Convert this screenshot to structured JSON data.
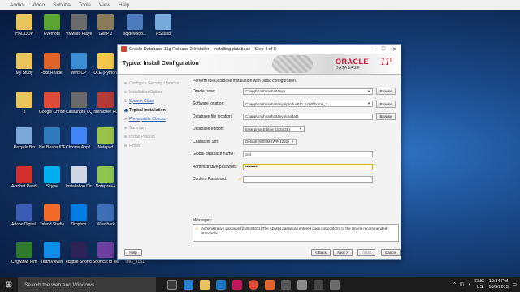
{
  "player_menu": [
    "Audio",
    "Video",
    "Subtitle",
    "Tools",
    "View",
    "Help"
  ],
  "desktop_icons": [
    {
      "label": "HADOOP",
      "icon": "folder-icon",
      "color": "#e9c45b"
    },
    {
      "label": "Evernote",
      "icon": "evernote-icon",
      "color": "#5aa432"
    },
    {
      "label": "VMware Player",
      "icon": "vmware-icon",
      "color": "#6b6b6b"
    },
    {
      "label": "GIMP 2",
      "icon": "gimp-icon",
      "color": "#8b7b5b"
    },
    {
      "label": "sqldevelop...",
      "icon": "sqldeveloper-icon",
      "color": "#4c7bbd"
    },
    {
      "label": "RStudio",
      "icon": "rstudio-icon",
      "color": "#75aadb"
    },
    {
      "label": "My Study",
      "icon": "folder-icon",
      "color": "#e9c45b"
    },
    {
      "label": "Foxit Reader",
      "icon": "foxit-icon",
      "color": "#e0632a"
    },
    {
      "label": "WinSCP",
      "icon": "winscp-icon",
      "color": "#3a8fd6"
    },
    {
      "label": "IDLE (Python GUI)",
      "icon": "python-icon",
      "color": "#f2c94c"
    },
    {
      "label": "8",
      "icon": "folder-icon",
      "color": "#e9c45b"
    },
    {
      "label": "Google Chrome",
      "icon": "chrome-icon",
      "color": "#dd4b39"
    },
    {
      "label": "Cassandra CQL Shell",
      "icon": "cassandra-icon",
      "color": "#6a6a6a"
    },
    {
      "label": "Interactive Ruby",
      "icon": "ruby-icon",
      "color": "#b33a3a"
    },
    {
      "label": "Recycle Bin",
      "icon": "recycle-bin-icon",
      "color": "#7aa7d8"
    },
    {
      "label": "Net Beans IDE 8.0.2",
      "icon": "netbeans-icon",
      "color": "#2f7bbd"
    },
    {
      "label": "Chrome App Launcher",
      "icon": "app-launcher-icon",
      "color": "#4285f4"
    },
    {
      "label": "Notepad",
      "icon": "notepad-icon",
      "color": "#9bc34a"
    },
    {
      "label": "Acrobat Reader DC",
      "icon": "acrobat-icon",
      "color": "#d32f2f"
    },
    {
      "label": "Skype",
      "icon": "skype-icon",
      "color": "#00aff0"
    },
    {
      "label": "Installation Directive",
      "icon": "document-icon",
      "color": "#cfd8e3"
    },
    {
      "label": "Notepad++",
      "icon": "notepadpp-icon",
      "color": "#8fc650"
    },
    {
      "label": "Adobe Digital Ed...",
      "icon": "digital-editions-icon",
      "color": "#3b5bb5"
    },
    {
      "label": "Talend Studio",
      "icon": "talend-icon",
      "color": "#f26b2a"
    },
    {
      "label": "Dropbox",
      "icon": "dropbox-icon",
      "color": "#007ee5"
    },
    {
      "label": "Wireshark",
      "icon": "wireshark-icon",
      "color": "#3d6fb6"
    },
    {
      "label": "CygwinM Terminal",
      "icon": "cygwin-icon",
      "color": "#2d7a2d"
    },
    {
      "label": "TeamViewer",
      "icon": "teamviewer-icon",
      "color": "#0e8ee9"
    },
    {
      "label": "eclipse Shortcut",
      "icon": "eclipse-icon",
      "color": "#2c2255"
    },
    {
      "label": "Shortcut to Winst...",
      "icon": "shortcut-icon",
      "color": "#6a3fa0"
    },
    {
      "label": "IMG_9151",
      "icon": "image-icon",
      "color": "#8a9bb0"
    }
  ],
  "window": {
    "title": "Oracle Database 11g Release 2 Installer - Installing database - Step 4 of 8",
    "heading": "Typical Install Configuration",
    "brand": "ORACLE",
    "brand_sub": "DATABASE",
    "version": "11",
    "version_sup": "g",
    "steps": [
      {
        "label": "Configure Security Updates",
        "state": "done"
      },
      {
        "label": "Installation Option",
        "state": "done"
      },
      {
        "label": "System Class",
        "state": "link"
      },
      {
        "label": "Typical Installation",
        "state": "current"
      },
      {
        "label": "Prerequisite Checks",
        "state": "link"
      },
      {
        "label": "Summary",
        "state": "pending"
      },
      {
        "label": "Install Product",
        "state": "pending"
      },
      {
        "label": "Finish",
        "state": "pending"
      }
    ],
    "intro": "Perform full Database installation with basic configuration.",
    "fields": {
      "oracle_base": {
        "label": "Oracle base:",
        "value": "C:\\app\\Krishnachaitanya",
        "browse": "Browse"
      },
      "software_location": {
        "label": "Software location:",
        "value": "C:\\app\\Krishnachaitanya\\product\\11.2.0\\dbhome_1",
        "browse": "Browse"
      },
      "database_file_location": {
        "label": "Database file location:",
        "value": "C:\\app\\Krishnachaitanya\\oradata",
        "browse": "Browse"
      },
      "database_edition": {
        "label": "Database edition:",
        "value": "Enterprise Edition (3.34GB)"
      },
      "character_set": {
        "label": "Character Set:",
        "value": "Default (WE8MSWIN1252)"
      },
      "global_database_name": {
        "label": "Global database name:",
        "value": "orcl"
      },
      "administrative_password": {
        "label": "Administrative password:",
        "value": "•••••••••"
      },
      "confirm_password": {
        "label": "Confirm Password:",
        "value": ""
      }
    },
    "messages_label": "Messages:",
    "message": "Administrative password:[INS-30011] The ADMIN password entered does not conform to the Oracle recommended standards.",
    "buttons": {
      "help": "Help",
      "back": "< Back",
      "next": "Next >",
      "install": "Install",
      "cancel": "Cancel"
    }
  },
  "taskbar": {
    "search_placeholder": "Search the web and Windows",
    "lang": "ENG",
    "region": "US",
    "time": "10:34 PM",
    "date": "10/5/2015"
  }
}
